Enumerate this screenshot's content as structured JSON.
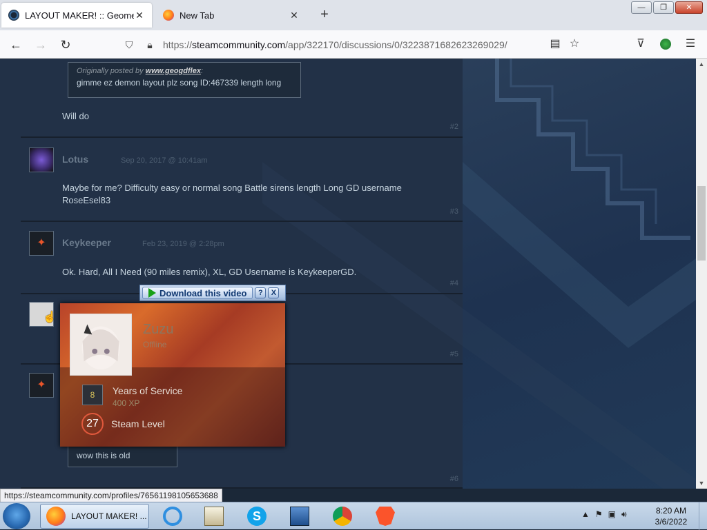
{
  "browser": {
    "tabs": [
      {
        "title": "LAYOUT MAKER! :: Geometry D",
        "active": true
      },
      {
        "title": "New Tab",
        "active": false
      }
    ],
    "url_prefix": "https://",
    "url_domain": "steamcommunity.com",
    "url_path": "/app/322170/discussions/0/3223871682623269029/",
    "window_buttons": {
      "minimize": "—",
      "restore": "❐",
      "close": "✕"
    }
  },
  "posts": [
    {
      "quote_prefix": "Originally posted by",
      "quote_author": "www.geogdflex",
      "quote_suffix": ":",
      "quote_text": "gimme ez demon layout plz song ID:467339 length long",
      "body": "Will do",
      "number": "#2"
    },
    {
      "author": "Lotus",
      "date": "Sep 20, 2017 @ 10:41am",
      "body": "Maybe for me? Difficulty easy or normal song Battle sirens length Long GD username RoseEsel83",
      "number": "#3"
    },
    {
      "author": "Keykeeper",
      "date": "Feb 23, 2019 @ 2:28pm",
      "body": "Ok. Hard, All I Need (90 miles remix), XL, GD Username is KeykeeperGD.",
      "number": "#4"
    },
    {
      "number": "#5"
    },
    {
      "quote_text": "wow this is old",
      "number": "#6"
    }
  ],
  "download_bar": {
    "label": "Download this video",
    "help": "?",
    "close": "X"
  },
  "profile_card": {
    "name": "Zuzu",
    "status": "Offline",
    "years_icon_text": "8",
    "years_label": "Years of Service",
    "xp": "400 XP",
    "level": "27",
    "level_label": "Steam Level"
  },
  "status_url": "https://steamcommunity.com/profiles/76561198105653688",
  "taskbar": {
    "active_window": "LAYOUT MAKER! ...",
    "time": "8:20 AM",
    "date": "3/6/2022"
  },
  "colors": {
    "page_bg": "#223147",
    "text": "#c6d4df",
    "card_accent": "#e0583c"
  }
}
